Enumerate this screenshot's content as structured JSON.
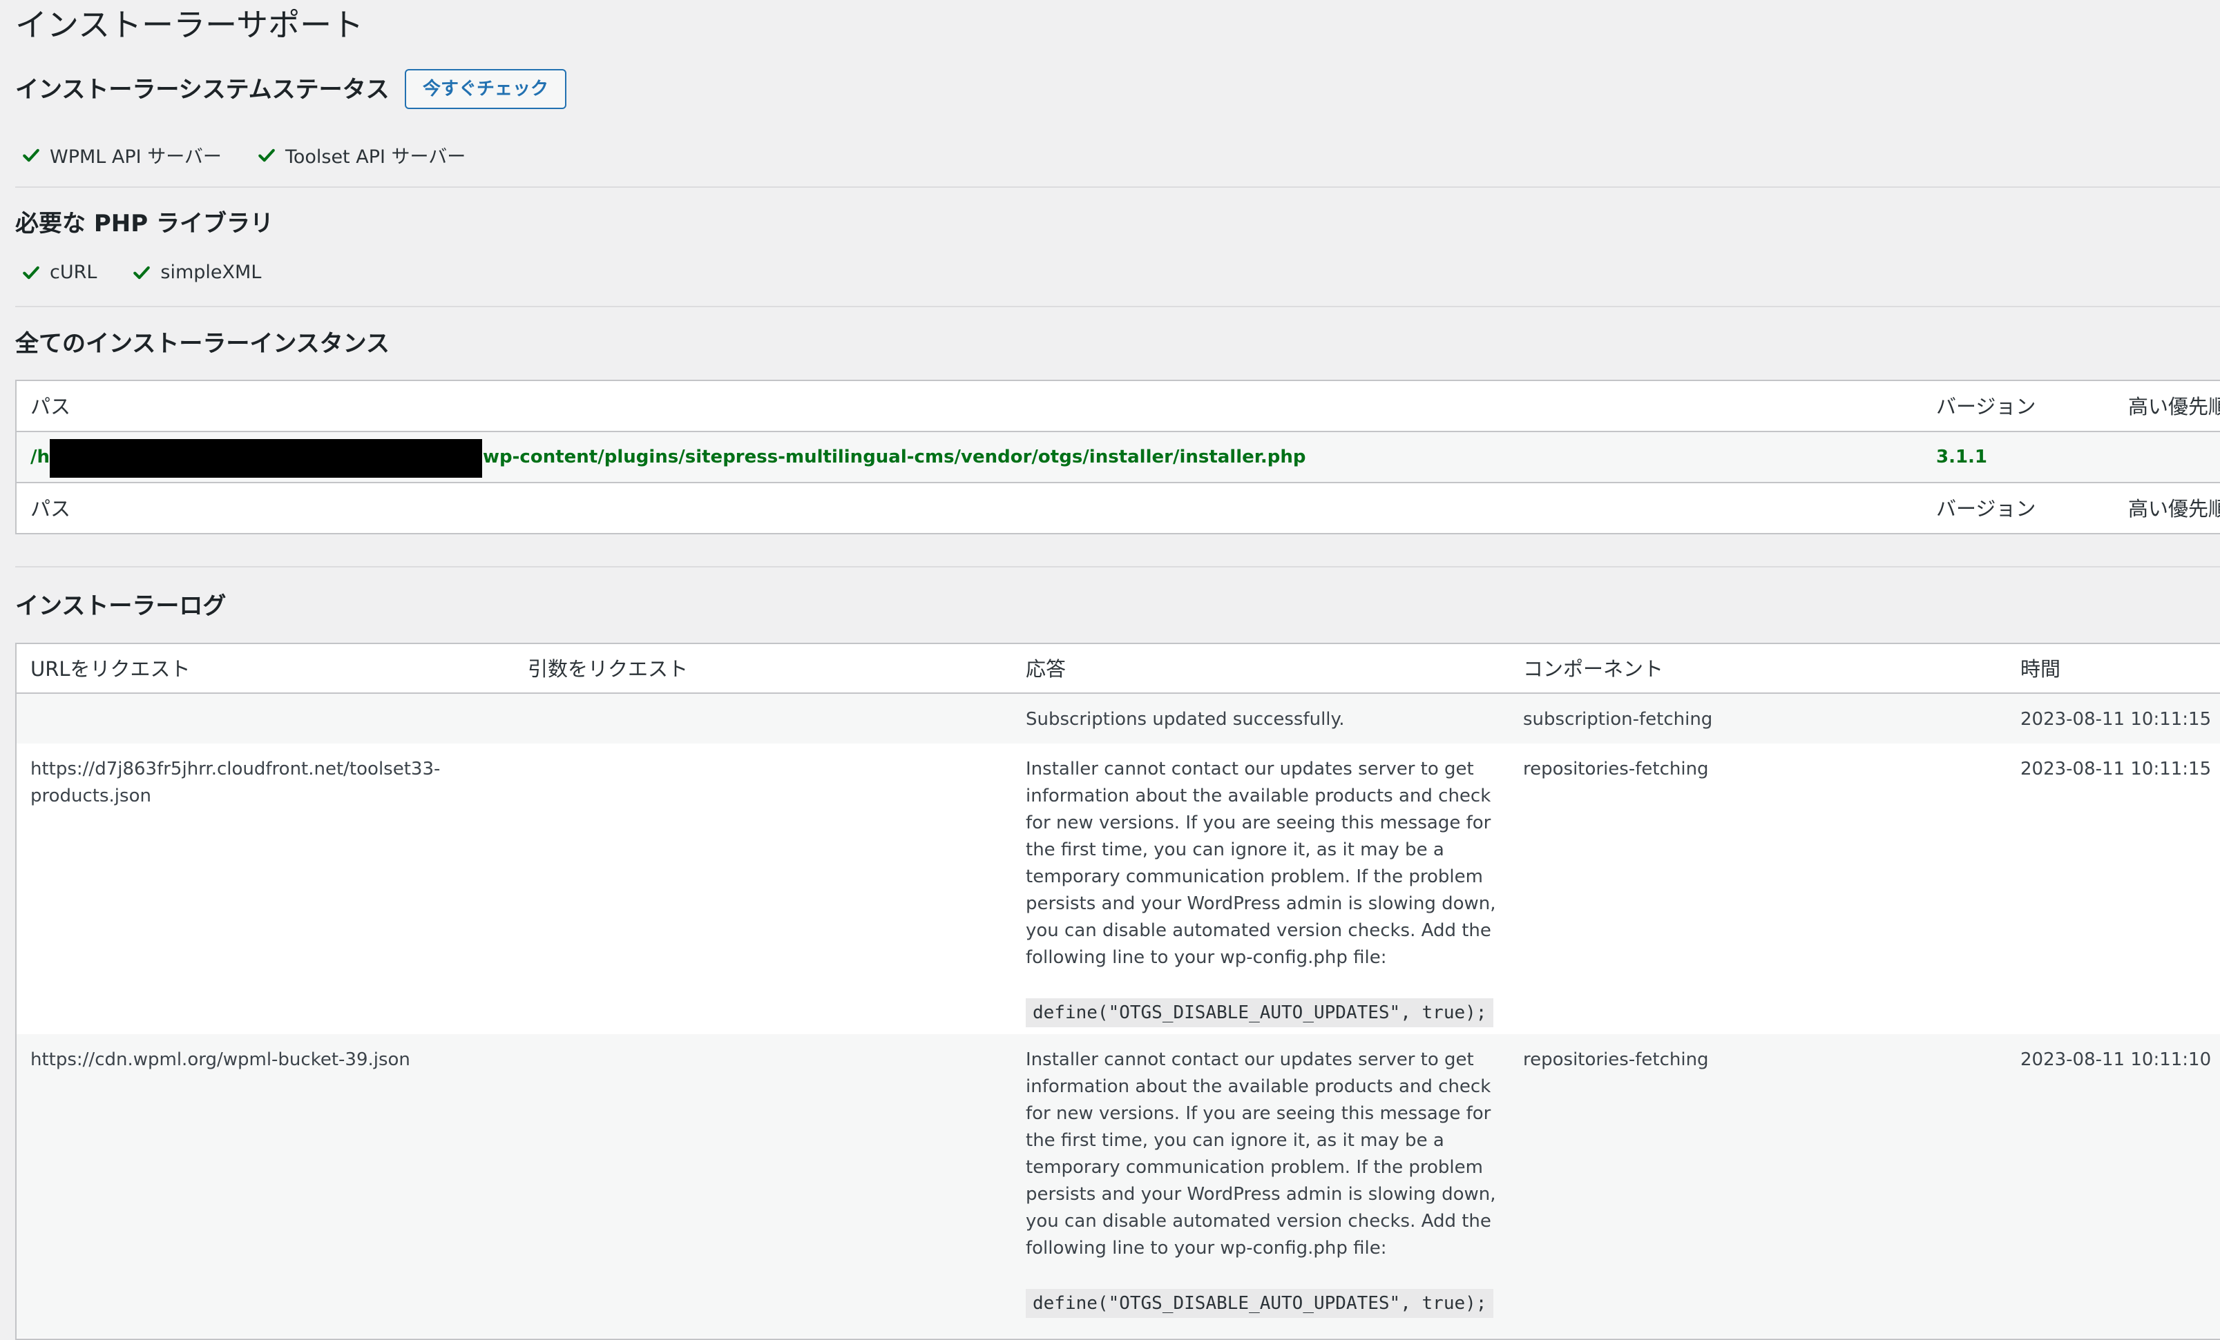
{
  "page": {
    "title": "インストーラーサポート"
  },
  "system_status": {
    "heading": "インストーラーシステムステータス",
    "check_now_label": "今すぐチェック",
    "items": [
      {
        "label": "WPML API サーバー",
        "status": "ok"
      },
      {
        "label": "Toolset API サーバー",
        "status": "ok"
      }
    ]
  },
  "php_libraries": {
    "heading": "必要な PHP ライブラリ",
    "items": [
      {
        "label": "cURL",
        "status": "ok"
      },
      {
        "label": "simpleXML",
        "status": "ok"
      }
    ]
  },
  "instances": {
    "heading": "全てのインストーラーインスタンス",
    "columns": {
      "path": "パス",
      "version": "バージョン",
      "priority": "高い優先順"
    },
    "rows": [
      {
        "path_prefix": "/h",
        "path_suffix": "wp-content/plugins/sitepress-multilingual-cms/vendor/otgs/installer/installer.php",
        "version": "3.1.1"
      }
    ]
  },
  "log": {
    "heading": "インストーラーログ",
    "columns": {
      "url": "URLをリクエスト",
      "args": "引数をリクエスト",
      "response": "応答",
      "component": "コンポーネント",
      "time": "時間"
    },
    "rows": [
      {
        "url": "",
        "args": "",
        "response": "Subscriptions updated successfully.",
        "code": "",
        "component": "subscription-fetching",
        "time": "2023-08-11 10:11:15"
      },
      {
        "url": "https://d7j863fr5jhrr.cloudfront.net/toolset33-products.json",
        "args": "",
        "response": "Installer cannot contact our updates server to get information about the available products and check for new versions. If you are seeing this message for the first time, you can ignore it, as it may be a temporary communication problem. If the problem persists and your WordPress admin is slowing down, you can disable automated version checks. Add the following line to your wp-config.php file:",
        "code": "define(\"OTGS_DISABLE_AUTO_UPDATES\", true);",
        "component": "repositories-fetching",
        "time": "2023-08-11 10:11:15"
      },
      {
        "url": "https://cdn.wpml.org/wpml-bucket-39.json",
        "args": "",
        "response": "Installer cannot contact our updates server to get information about the available products and check for new versions. If you are seeing this message for the first time, you can ignore it, as it may be a temporary communication problem. If the problem persists and your WordPress admin is slowing down, you can disable automated version checks. Add the following line to your wp-config.php file:",
        "code": "define(\"OTGS_DISABLE_AUTO_UPDATES\", true);",
        "component": "repositories-fetching",
        "time": "2023-08-11 10:11:10"
      }
    ]
  },
  "colors": {
    "ok_green": "#007017",
    "accent_blue": "#2271b1",
    "background": "#f0f0f1"
  }
}
